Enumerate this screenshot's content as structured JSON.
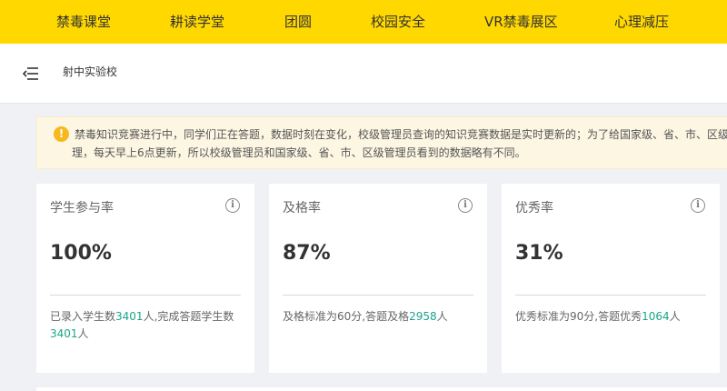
{
  "topnav": {
    "items": [
      "禁毒课堂",
      "耕读学堂",
      "团圆",
      "校园安全",
      "VR禁毒展区",
      "心理减压"
    ]
  },
  "header": {
    "school_name": "射中实验校",
    "menu_icon": "menu-collapse-icon"
  },
  "notice": {
    "icon": "warning-icon",
    "line1": "禁毒知识竞赛进行中，同学们正在答题，数据时刻在变化，校级管理员查询的知识竞赛数据是实时更新的；为了给国家级、省、市、区级",
    "line2": "理，每天早上6点更新，所以校级管理员和国家级、省、市、区级管理员看到的数据略有不同。"
  },
  "cards": [
    {
      "title": "学生参与率",
      "value": "100%",
      "desc_parts": [
        "已录入学生数",
        "3401",
        "人,完成答题学生数",
        "3401",
        "人"
      ]
    },
    {
      "title": "及格率",
      "value": "87%",
      "desc_parts": [
        "及格标准为60分,答题及格",
        "2958",
        "人"
      ]
    },
    {
      "title": "优秀率",
      "value": "31%",
      "desc_parts": [
        "优秀标准为90分,答题优秀",
        "1064",
        "人"
      ]
    }
  ],
  "colors": {
    "nav_bg": "#ffd800",
    "highlight": "#1aa58a",
    "notice_bg": "#fdf6e3",
    "warning": "#f6b81c"
  }
}
